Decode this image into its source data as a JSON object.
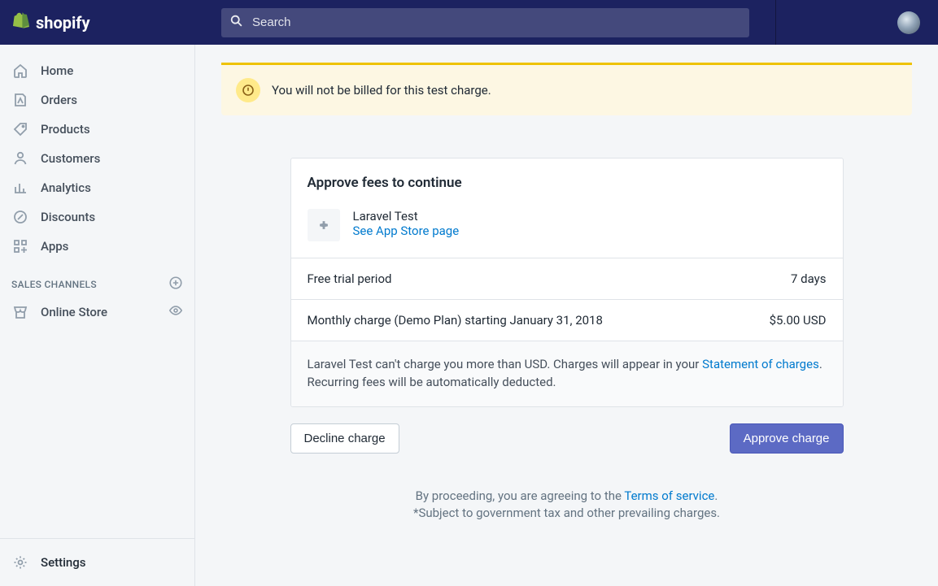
{
  "brand": "shopify",
  "search": {
    "placeholder": "Search"
  },
  "sidebar": {
    "items": [
      {
        "label": "Home"
      },
      {
        "label": "Orders"
      },
      {
        "label": "Products"
      },
      {
        "label": "Customers"
      },
      {
        "label": "Analytics"
      },
      {
        "label": "Discounts"
      },
      {
        "label": "Apps"
      }
    ],
    "section_label": "SALES CHANNELS",
    "channels": [
      {
        "label": "Online Store"
      }
    ],
    "settings_label": "Settings"
  },
  "banner": {
    "message": "You will not be billed for this test charge."
  },
  "card": {
    "title": "Approve fees to continue",
    "app_name": "Laravel Test",
    "app_link": "See App Store page",
    "trial_label": "Free trial period",
    "trial_value": "7 days",
    "charge_label": "Monthly charge (Demo Plan) starting January 31, 2018",
    "charge_value": "$5.00 USD",
    "note_prefix": "Laravel Test can't charge you more than USD. Charges will appear in your ",
    "note_link": "Statement of charges",
    "note_suffix": ". Recurring fees will be automatically deducted."
  },
  "actions": {
    "decline": "Decline charge",
    "approve": "Approve charge"
  },
  "terms": {
    "line1_prefix": "By proceeding, you are agreeing to the ",
    "line1_link": "Terms of service",
    "line1_suffix": ".",
    "line2": "*Subject to government tax and other prevailing charges."
  }
}
